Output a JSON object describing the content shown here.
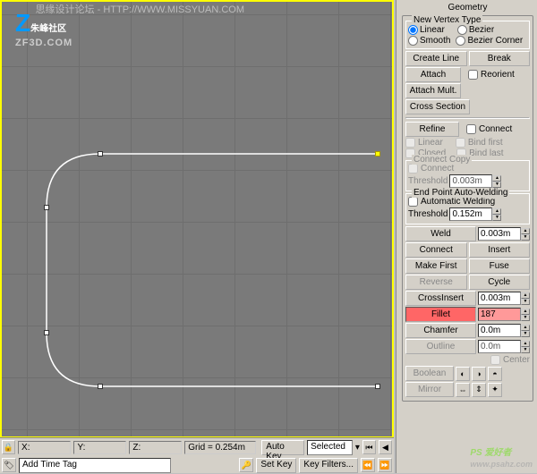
{
  "watermarks": {
    "logo_text": "朱峰社区",
    "logo_url": "ZF3D.COM",
    "top": "思缘设计论坛 - HTTP://WWW.MISSYUAN.COM",
    "bottom": "PS 爱好者",
    "bottom_url": "www.psahz.com"
  },
  "viewport": {
    "grid_spacing": 58
  },
  "panel": {
    "rollout_title": "Geometry",
    "vertex_type": {
      "title": "New Vertex Type",
      "opts": [
        "Linear",
        "Bezier",
        "Smooth",
        "Bezier Corner"
      ],
      "selected": "Linear"
    },
    "buttons": {
      "create_line": "Create Line",
      "break": "Break",
      "attach": "Attach",
      "attach_mult": "Attach Mult.",
      "reorient": "Reorient",
      "cross_section": "Cross Section",
      "refine": "Refine",
      "connect_chk": "Connect",
      "linear": "Linear",
      "bind_first": "Bind first",
      "closed": "Closed",
      "bind_last": "Bind last"
    },
    "connect_copy": {
      "title": "Connect Copy",
      "connect": "Connect",
      "threshold": "Threshold",
      "threshold_val": "0.003m"
    },
    "autoweld": {
      "title": "End Point Auto-Welding",
      "automatic": "Automatic Welding",
      "threshold": "Threshold",
      "threshold_val": "0.152m"
    },
    "ops": {
      "weld": "Weld",
      "weld_val": "0.003m",
      "connect": "Connect",
      "insert": "Insert",
      "make_first": "Make First",
      "fuse": "Fuse",
      "reverse": "Reverse",
      "cycle": "Cycle",
      "crossinsert": "CrossInsert",
      "crossinsert_val": "0.003m",
      "fillet": "Fillet",
      "fillet_val": "187",
      "chamfer": "Chamfer",
      "chamfer_val": "0.0m",
      "outline": "Outline",
      "outline_val": "0.0m",
      "center": "Center",
      "boolean": "Boolean",
      "mirror": "Mirror"
    }
  },
  "status": {
    "x": "X:",
    "y": "Y:",
    "z": "Z:",
    "grid": "Grid = 0.254m",
    "add_time_tag": "Add Time Tag",
    "auto_key": "Auto Key",
    "set_key": "Set Key",
    "selected": "Selected",
    "key_filters": "Key Filters..."
  }
}
